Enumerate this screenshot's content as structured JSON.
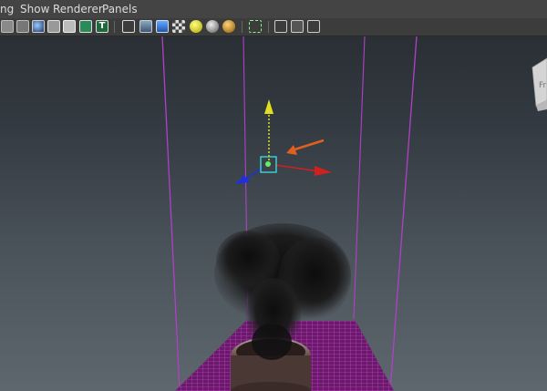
{
  "menu": {
    "items": [
      {
        "id": "lighting",
        "label": "ng"
      },
      {
        "id": "show",
        "label": "Show"
      },
      {
        "id": "renderer",
        "label": "Renderer"
      },
      {
        "id": "panels",
        "label": "Panels"
      }
    ]
  },
  "toolbar": {
    "buttons": [
      "wireframe-icon",
      "grid-display-icon",
      "smooth-shade-icon",
      "flat-shade-icon",
      "wireframe-on-shaded-icon",
      "bounding-box-icon",
      "textured-icon",
      "cube-wire-icon",
      "cube-shaded-icon",
      "cube-blue-icon",
      "checker-icon",
      "sphere-yellow-icon",
      "sphere-grey-icon",
      "sphere-gold-icon",
      "select-cursor-icon",
      "isolate-select-icon",
      "xray-icon",
      "share-graph-icon"
    ]
  },
  "viewcube": {
    "face_label": "Fr"
  },
  "colors": {
    "container_edge": "#c040d0",
    "grid": "#b030b0",
    "axis_x": "#d02020",
    "axis_y": "#e0e020",
    "axis_z": "#2030e0",
    "manip_center": "#40e0e0",
    "rotate_arrow": "#e06020",
    "menu_bg": "#444444",
    "toolbar_bg": "#3c3c3c"
  }
}
